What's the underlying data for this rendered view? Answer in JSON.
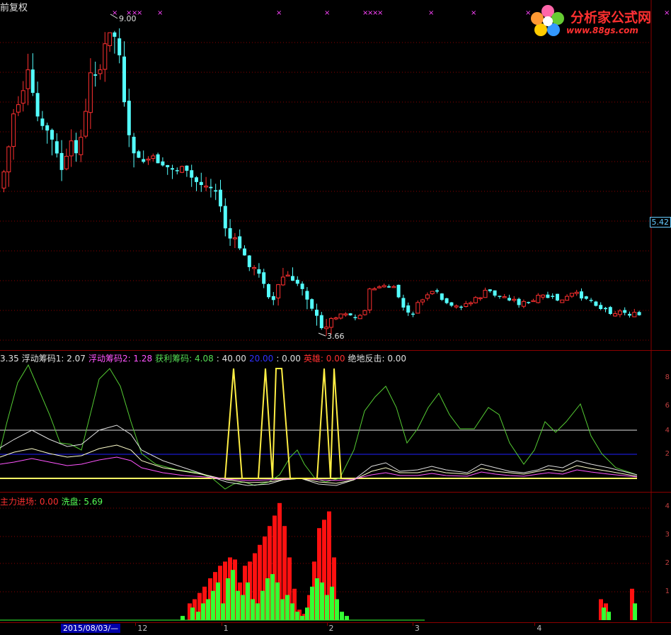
{
  "main_chart": {
    "title": "前复权",
    "high_label": "9.00",
    "low_label": "3.66",
    "price_box": "5.42",
    "marker_glyph": "×"
  },
  "indicator1": {
    "legend": [
      {
        "text": "3.35",
        "color": "#e0e0e0"
      },
      {
        "text": "浮动筹码1: 2.07",
        "color": "#e0e0e0"
      },
      {
        "text": "浮动筹码2: 1.28",
        "color": "#ff55ff"
      },
      {
        "text": "获利筹码: 4.08",
        "color": "#55dd55"
      },
      {
        "text": ": 40.00",
        "color": "#e0e0e0"
      },
      {
        "text": "20.00",
        "color": "#3030ff"
      },
      {
        "text": ": 0.00",
        "color": "#e0e0e0"
      },
      {
        "text": "英雄: 0.00",
        "color": "#ff3030"
      },
      {
        "text": "绝地反击: 0.00",
        "color": "#e0e0e0"
      }
    ],
    "axis_ticks": [
      "8",
      "6",
      "4",
      "2"
    ]
  },
  "indicator2": {
    "legend": [
      {
        "text": "主力进场: 0.00",
        "color": "#ff3030"
      },
      {
        "text": "洗盘: 5.69",
        "color": "#55ff55"
      }
    ],
    "axis_ticks": [
      "4",
      "3",
      "2",
      "1"
    ],
    "red_bars": [
      [
        265,
        8
      ],
      [
        272,
        10
      ],
      [
        279,
        13
      ],
      [
        286,
        16
      ],
      [
        294,
        20
      ],
      [
        301,
        23
      ],
      [
        308,
        26
      ],
      [
        315,
        28
      ],
      [
        322,
        30
      ],
      [
        329,
        29
      ],
      [
        336,
        18
      ],
      [
        343,
        26
      ],
      [
        350,
        28
      ],
      [
        357,
        32
      ],
      [
        364,
        36
      ],
      [
        371,
        40
      ],
      [
        378,
        45
      ],
      [
        385,
        50
      ],
      [
        392,
        56
      ],
      [
        399,
        45
      ],
      [
        406,
        30
      ],
      [
        413,
        15
      ],
      [
        420,
        5
      ],
      [
        427,
        3
      ],
      [
        434,
        12
      ],
      [
        441,
        28
      ],
      [
        448,
        44
      ],
      [
        455,
        48
      ],
      [
        462,
        52
      ],
      [
        469,
        30
      ],
      [
        846,
        10
      ],
      [
        853,
        8
      ],
      [
        890,
        15
      ]
    ],
    "green_bars": [
      [
        258,
        2
      ],
      [
        272,
        6
      ],
      [
        280,
        4
      ],
      [
        287,
        8
      ],
      [
        294,
        10
      ],
      [
        301,
        14
      ],
      [
        308,
        18
      ],
      [
        315,
        8
      ],
      [
        322,
        20
      ],
      [
        329,
        24
      ],
      [
        336,
        14
      ],
      [
        343,
        12
      ],
      [
        350,
        18
      ],
      [
        357,
        10
      ],
      [
        364,
        8
      ],
      [
        371,
        14
      ],
      [
        378,
        20
      ],
      [
        385,
        22
      ],
      [
        392,
        18
      ],
      [
        399,
        10
      ],
      [
        406,
        12
      ],
      [
        413,
        8
      ],
      [
        420,
        4
      ],
      [
        427,
        2
      ],
      [
        434,
        6
      ],
      [
        441,
        16
      ],
      [
        448,
        20
      ],
      [
        455,
        18
      ],
      [
        462,
        12
      ],
      [
        469,
        16
      ],
      [
        476,
        10
      ],
      [
        483,
        4
      ],
      [
        490,
        2
      ],
      [
        853,
        6
      ],
      [
        860,
        4
      ],
      [
        897,
        8
      ]
    ]
  },
  "time_axis": {
    "date_box": "2015/08/03/—",
    "labels": [
      {
        "text": "12",
        "x": 0.205
      },
      {
        "text": "1",
        "x": 0.333
      },
      {
        "text": "2",
        "x": 0.49
      },
      {
        "text": "3",
        "x": 0.618
      },
      {
        "text": "4",
        "x": 0.8
      }
    ]
  },
  "logo": {
    "brand": "分析家公式网",
    "url": "www.88gs.com"
  },
  "colors": {
    "up_candle": "#ff3030",
    "down_candle": "#54ffff",
    "grid": "#8b0000"
  }
}
